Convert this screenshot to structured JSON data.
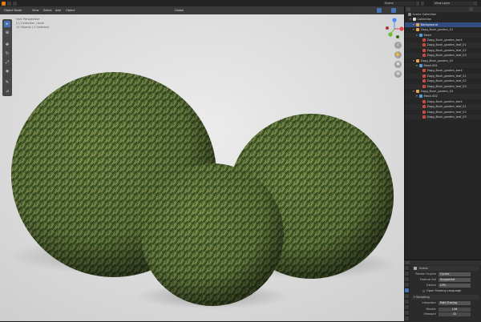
{
  "topbar": {
    "scene_label": "Scene",
    "view_layer_label": "View Layer",
    "global_label": "Global"
  },
  "viewport": {
    "mode_label": "Object Mode",
    "menus": [
      "View",
      "Select",
      "Add",
      "Object"
    ],
    "info_lines": [
      "User Perspective",
      "(1) Collection | bush",
      "10 Objects | 0 Selected"
    ]
  },
  "outliner": {
    "header": "Scene Collection",
    "rows": [
      {
        "label": "Collection",
        "depth": 1,
        "icon": "collection-icon",
        "selected": false
      },
      {
        "label": "Background",
        "depth": 2,
        "icon": "object-icon",
        "selected": true
      },
      {
        "label": "Zagg_Bush_garden_01",
        "depth": 2,
        "icon": "object-icon",
        "selected": false
      },
      {
        "label": "Mesh",
        "depth": 3,
        "icon": "mesh-icon",
        "selected": false
      },
      {
        "label": "Zagg_Bush_garden_bark",
        "depth": 4,
        "icon": "material-icon",
        "selected": false
      },
      {
        "label": "Zagg_Bush_garden_leaf_01",
        "depth": 4,
        "icon": "material-icon",
        "selected": false
      },
      {
        "label": "Zagg_Bush_garden_leaf_02",
        "depth": 4,
        "icon": "material-icon",
        "selected": false
      },
      {
        "label": "Zagg_Bush_garden_leaf_03",
        "depth": 4,
        "icon": "material-icon",
        "selected": false
      },
      {
        "label": "Zagg_Bush_garden_02",
        "depth": 2,
        "icon": "object-icon",
        "selected": false
      },
      {
        "label": "Mesh.001",
        "depth": 3,
        "icon": "mesh-icon",
        "selected": false
      },
      {
        "label": "Zagg_Bush_garden_bark",
        "depth": 4,
        "icon": "material-icon",
        "selected": false
      },
      {
        "label": "Zagg_Bush_garden_leaf_01",
        "depth": 4,
        "icon": "material-icon",
        "selected": false
      },
      {
        "label": "Zagg_Bush_garden_leaf_02",
        "depth": 4,
        "icon": "material-icon",
        "selected": false
      },
      {
        "label": "Zagg_Bush_garden_leaf_03",
        "depth": 4,
        "icon": "material-icon",
        "selected": false
      },
      {
        "label": "Zagg_Bush_garden_03",
        "depth": 2,
        "icon": "object-icon",
        "selected": false
      },
      {
        "label": "Mesh.002",
        "depth": 3,
        "icon": "mesh-icon",
        "selected": false
      },
      {
        "label": "Zagg_Bush_garden_bark",
        "depth": 4,
        "icon": "material-icon",
        "selected": false
      },
      {
        "label": "Zagg_Bush_garden_leaf_01",
        "depth": 4,
        "icon": "material-icon",
        "selected": false
      },
      {
        "label": "Zagg_Bush_garden_leaf_02",
        "depth": 4,
        "icon": "material-icon",
        "selected": false
      },
      {
        "label": "Zagg_Bush_garden_leaf_03",
        "depth": 4,
        "icon": "material-icon",
        "selected": false
      }
    ]
  },
  "properties": {
    "scene_label": "Scene",
    "fields": [
      {
        "label": "Render Engine",
        "value": "Cycles"
      },
      {
        "label": "Feature Set",
        "value": "Supported"
      },
      {
        "label": "Device",
        "value": "CPU"
      }
    ],
    "osl_label": "Open Shading Language",
    "sampling_label": "Sampling",
    "integrator_label": "Integrator",
    "integrator_value": "Path Tracing",
    "render_label": "Render",
    "render_value": "128",
    "viewport_label": "Viewport",
    "viewport_value": "32"
  },
  "colors": {
    "accent": "#4772b3",
    "selected_row": "#334d80",
    "viewport_bg": "#e4e4e4",
    "bush_foliage": "#4f6a30"
  }
}
